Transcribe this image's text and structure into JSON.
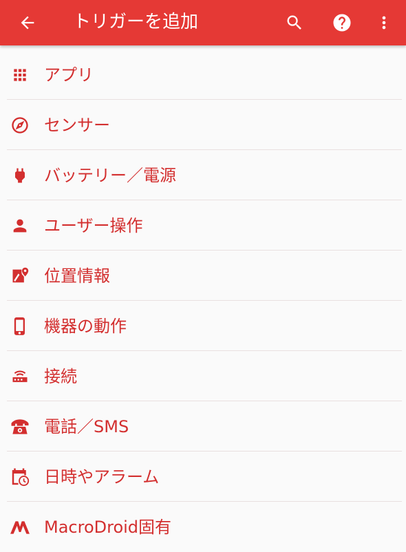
{
  "header": {
    "title": "トリガーを追加",
    "back_icon": "arrow-back-icon",
    "search_icon": "search-icon",
    "help_icon": "help-icon",
    "more_icon": "more-vert-icon"
  },
  "colors": {
    "primary": "#e53935",
    "accent": "#d32f2f",
    "background": "#fafafa"
  },
  "categories": [
    {
      "label": "アプリ",
      "icon": "apps-grid-icon"
    },
    {
      "label": "センサー",
      "icon": "compass-icon"
    },
    {
      "label": "バッテリー／電源",
      "icon": "power-plug-icon"
    },
    {
      "label": "ユーザー操作",
      "icon": "person-icon"
    },
    {
      "label": "位置情報",
      "icon": "map-pin-icon"
    },
    {
      "label": "機器の動作",
      "icon": "phone-device-icon"
    },
    {
      "label": "接続",
      "icon": "router-icon"
    },
    {
      "label": "電話／SMS",
      "icon": "telephone-icon"
    },
    {
      "label": "日時やアラーム",
      "icon": "calendar-clock-icon"
    },
    {
      "label": "MacroDroid固有",
      "icon": "macrodroid-logo-icon"
    }
  ]
}
